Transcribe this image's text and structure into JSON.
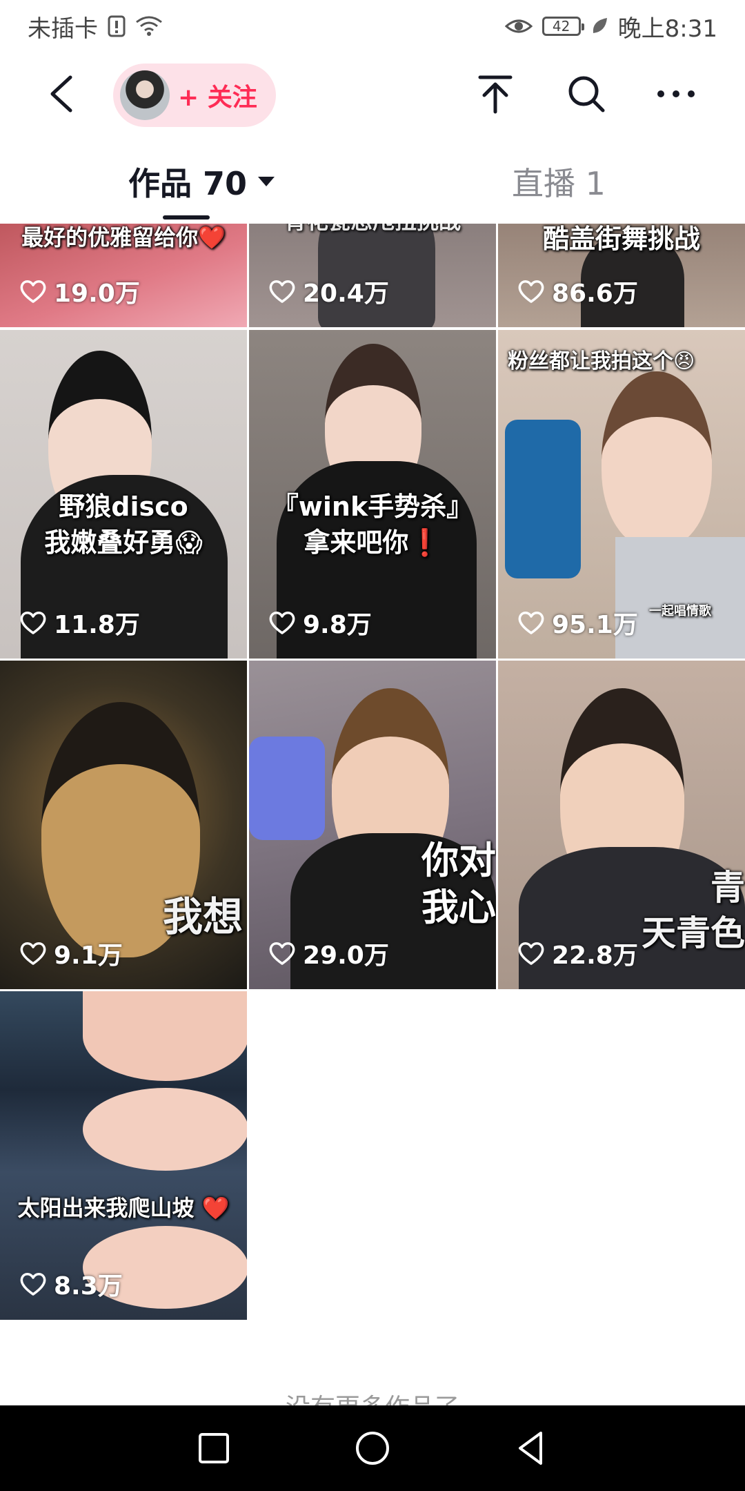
{
  "status_bar": {
    "carrier": "未插卡",
    "battery": "42",
    "time": "晚上8:31"
  },
  "header": {
    "follow_label": "+ 关注",
    "icons": [
      "back-arrow-icon",
      "upload-top-icon",
      "search-icon",
      "more-icon"
    ]
  },
  "tabs": [
    {
      "label": "作品 70",
      "active": true
    },
    {
      "label": "直播 1",
      "active": false
    }
  ],
  "videos": [
    {
      "caption": "最好的优雅留给你❤️",
      "likes": "19.0万"
    },
    {
      "caption": "青花瓷恋甩扭挑战",
      "likes": "20.4万"
    },
    {
      "caption": "酷盖街舞挑战",
      "likes": "86.6万"
    },
    {
      "caption": "野狼disco\n我嫩叠好勇😱",
      "likes": "11.8万"
    },
    {
      "caption": "『wink手势杀』\n拿来吧你❗",
      "likes": "9.8万"
    },
    {
      "caption": "粉丝都让我拍这个😠",
      "likes": "95.1万",
      "inset_caption": "一起唱情歌"
    },
    {
      "caption": "我想",
      "likes": "9.1万"
    },
    {
      "caption": "你对\n我心",
      "likes": "29.0万"
    },
    {
      "caption": "青\n天青色",
      "likes": "22.8万"
    },
    {
      "caption": "太阳出来我爬山坡 ❤️",
      "likes": "8.3万"
    }
  ],
  "end_text": "没有更多作品了",
  "colors": {
    "accent": "#fe2c55",
    "follow_bg": "#fde1e8",
    "text_primary": "#161823",
    "text_secondary": "#8a8b91"
  }
}
